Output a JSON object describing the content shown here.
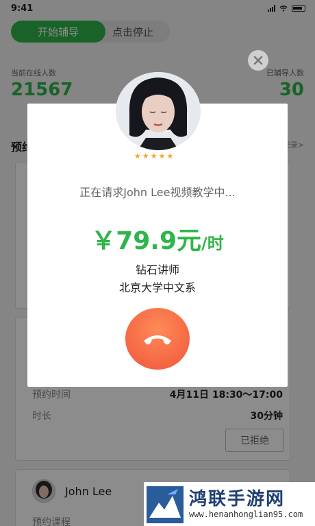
{
  "statusbar": {
    "time": "9:41"
  },
  "tabs": {
    "start": "开始辅导",
    "stop": "点击停止"
  },
  "stats": {
    "online_label": "当前在线人数",
    "online_value": "21567",
    "tutored_label": "已辅导人数",
    "tutored_value": "30"
  },
  "section": {
    "title": "预约",
    "link": "记录>"
  },
  "booking": {
    "time_label": "预约时间",
    "time_value": "4月11日  18:30～17:00",
    "duration_label": "时长",
    "duration_value": "30分钟",
    "reject_label": "已拒绝"
  },
  "next_card": {
    "name": "John Lee",
    "course_label": "预约课程"
  },
  "modal": {
    "rating": 5,
    "request_text": "正在请求John Lee视频教学中...",
    "price": "￥79.9元",
    "price_unit": "/时",
    "teacher_level": "钻石讲师",
    "department": "北京大学中文系"
  },
  "watermark": {
    "title": "鸿联手游网",
    "url": "www.henanhonglian95.com"
  },
  "colors": {
    "accent": "#2fb54a",
    "hangup": "#f0563a",
    "star": "#f5a623"
  }
}
